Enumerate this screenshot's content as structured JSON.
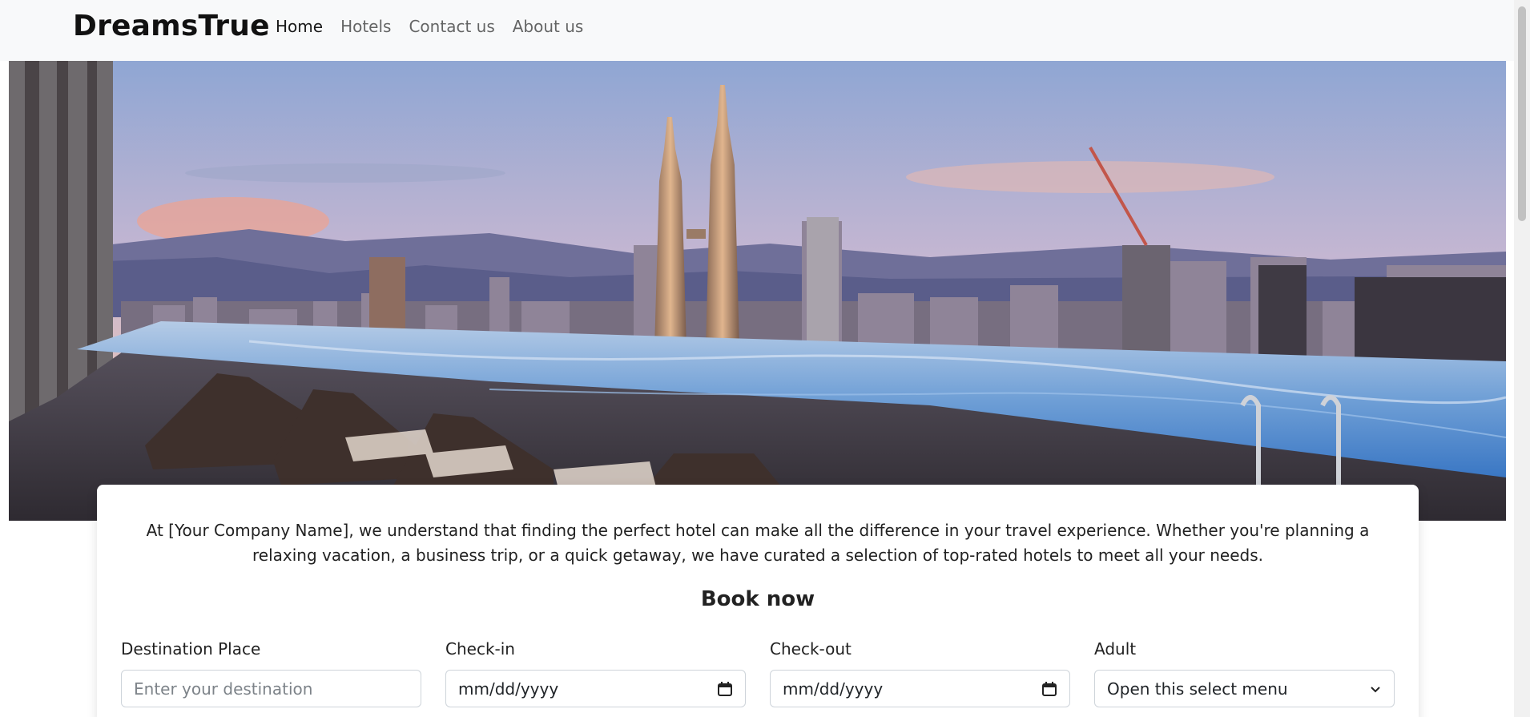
{
  "header": {
    "brand": "DreamsTrue",
    "nav": [
      {
        "label": "Home",
        "active": true
      },
      {
        "label": "Hotels",
        "active": false
      },
      {
        "label": "Contact us",
        "active": false
      },
      {
        "label": "About us",
        "active": false
      }
    ]
  },
  "hero": {
    "alt": "rooftop infinity pool city skyline"
  },
  "card": {
    "intro": "At [Your Company Name], we understand that finding the perfect hotel can make all the difference in your travel experience. Whether you're planning a relaxing vacation, a business trip, or a quick getaway, we have curated a selection of top-rated hotels to meet all your needs.",
    "book_title": "Book now",
    "fields": {
      "destination": {
        "label": "Destination Place",
        "placeholder": "Enter your destination"
      },
      "checkin": {
        "label": "Check-in",
        "value": "mm/dd/yyyy"
      },
      "checkout": {
        "label": "Check-out",
        "value": "mm/dd/yyyy"
      },
      "adult": {
        "label": "Adult",
        "value": "Open this select menu"
      }
    }
  },
  "colors": {
    "navbar_bg": "#f8f9fa",
    "card_bg": "#ffffff",
    "border": "#ced4da"
  }
}
